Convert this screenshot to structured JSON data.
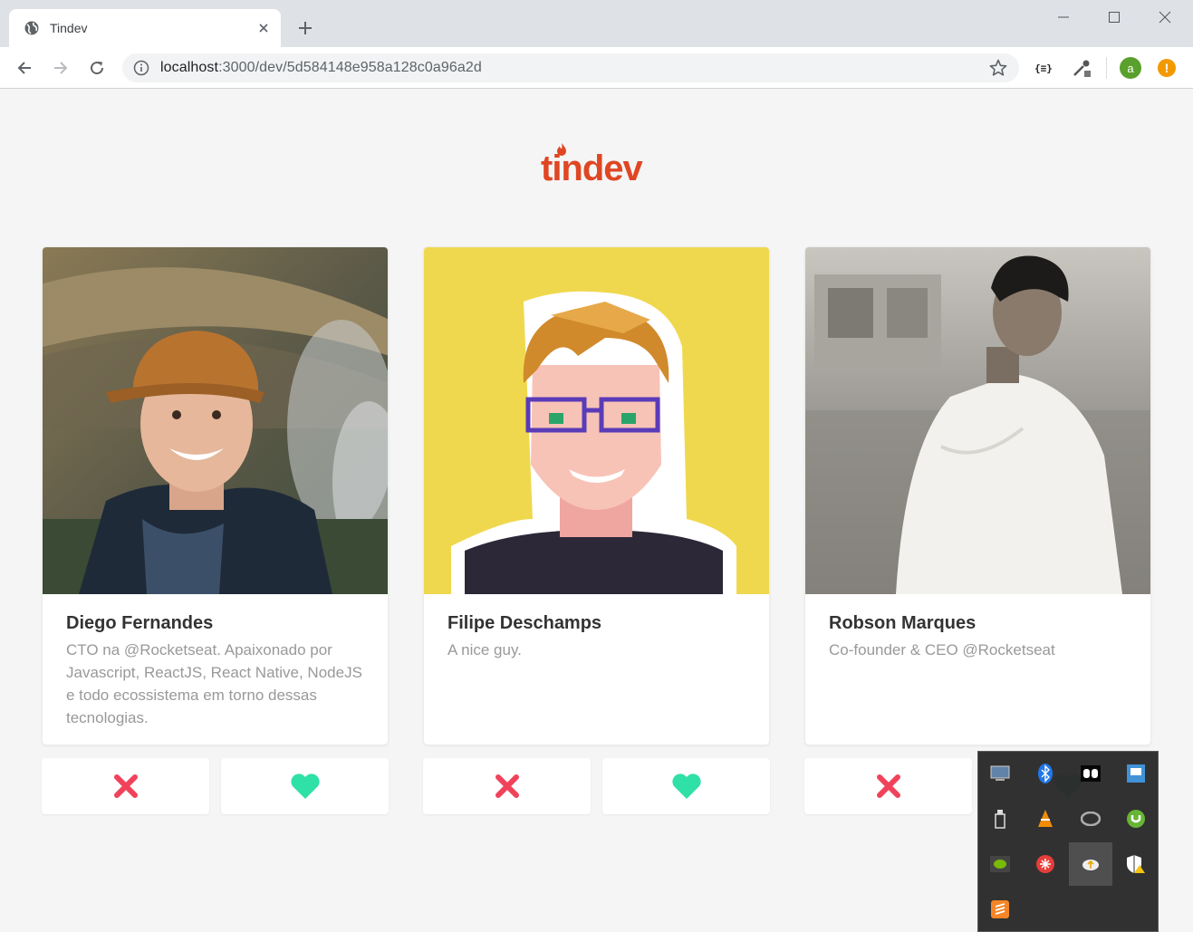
{
  "browser": {
    "tab_title": "Tindev",
    "url_host": "localhost",
    "url_path": ":3000/dev/5d584148e958a128c0a96a2d",
    "profile_initial": "a",
    "alert_symbol": "!"
  },
  "logo": {
    "text": "tindev",
    "color": "#df4723"
  },
  "devs": [
    {
      "name": "Diego Fernandes",
      "bio": "CTO na @Rocketseat. Apaixonado por Javascript, ReactJS, React Native, NodeJS e todo ecossistema em torno dessas tecnologias."
    },
    {
      "name": "Filipe Deschamps",
      "bio": "A nice guy."
    },
    {
      "name": "Robson Marques",
      "bio": "Co-founder & CEO @Rocketseat"
    }
  ],
  "actions": {
    "dislike_icon": "x-icon",
    "like_icon": "heart-icon",
    "dislike_color": "#f0435b",
    "like_color": "#2fe0a7"
  },
  "tray_icons": [
    "monitor-icon",
    "bluetooth-icon",
    "dolby-icon",
    "network-config-icon",
    "usb-drive-icon",
    "vlc-icon",
    "creative-cloud-icon",
    "utorrent-icon",
    "nvidia-icon",
    "red-asterisk-icon",
    "cloud-upload-icon",
    "security-warning-icon",
    "sublime-icon"
  ]
}
